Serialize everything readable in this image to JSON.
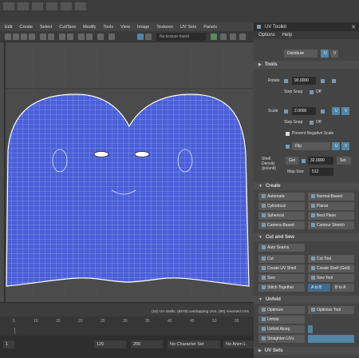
{
  "menubar": {
    "items": [
      "Edit",
      "Create",
      "Select",
      "Cut/Sew",
      "Modify",
      "Tools",
      "View",
      "Image",
      "Textures",
      "UV Sets",
      "Panels"
    ]
  },
  "toolbar": {
    "texture_field": "No texture found"
  },
  "viewport": {
    "mesh_color": "#4a5fd8",
    "grid_color": "#c8d0ff"
  },
  "status": {
    "message": "(15) UV shells, (6678) overlapping UVs, (90) reversed UVs"
  },
  "timeline": {
    "ticks": [
      "5",
      "10",
      "15",
      "20",
      "25",
      "30",
      "35",
      "40",
      "45",
      "50",
      "55"
    ]
  },
  "range": {
    "start": "1",
    "field1": "120",
    "field2": "200",
    "no_char": "No Character Set",
    "no_anim": "No Anim L"
  },
  "panel": {
    "title": "UV Toolkit",
    "menu": [
      "Options",
      "Help"
    ],
    "distribute_label": "Distribute",
    "u_label": "U",
    "v_label": "V",
    "tools_section": "Tools",
    "rotate_label": "Rotate",
    "rotate_value": "90.0000",
    "step_snap_label": "Step Snap",
    "step_snap_value": "Off",
    "scale_label": "Scale",
    "scale_value": "2.0000",
    "step_snap2_label": "Step Snap",
    "step_snap2_value": "Off",
    "prevent_neg": "Prevent Negative Scale",
    "flip_label": "Flip",
    "texel_label": "Shell Density (px/unit)",
    "get_label": "Get",
    "texel_value": "32.0000",
    "set_label": "Set",
    "map_size_label": "Map Size",
    "map_size_value": "512",
    "create_section": "Create",
    "create_buttons": [
      "Automatic",
      "Normal-Based",
      "Cylindrical",
      "Planar",
      "Spherical",
      "Best Plane",
      "Camera-Based",
      "Contour Stretch"
    ],
    "cutsew_section": "Cut and Sew",
    "auto_seams": "Auto Seams",
    "cut": "Cut",
    "cut_tool": "Cut Tool",
    "create_shell": "Create UV Shell",
    "create_shell_grid": "Create Shell (Grid)",
    "sew": "Sew",
    "sew_tool": "Sew Tool",
    "stitch": "Stitch Together",
    "a_to_b": "A to B",
    "b_to_a": "B to A",
    "unfold_section": "Unfold",
    "optimize": "Optimize",
    "optimize_tool": "Optimize Tool",
    "unfold": "Unfold",
    "unfold_along": "Unfold Along",
    "straighten": "Straighten UVs",
    "uvsets_section": "UV Sets"
  }
}
